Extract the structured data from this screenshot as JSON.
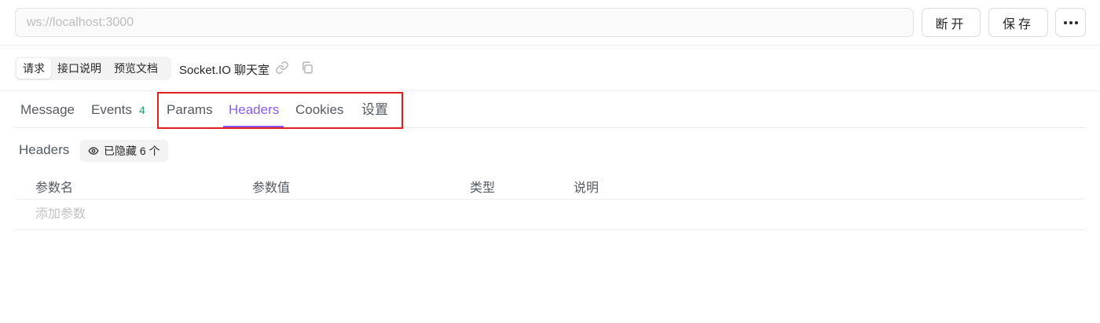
{
  "toolbar": {
    "url_placeholder": "ws://localhost:3000",
    "disconnect_label": "断开",
    "save_label": "保存",
    "more_icon": "more-horizontal-icon"
  },
  "subbar": {
    "segments": [
      "请求",
      "接口说明",
      "预览文档"
    ],
    "active_segment": "请求",
    "title": "Socket.IO 聊天室"
  },
  "tabs": {
    "items": [
      {
        "label": "Message"
      },
      {
        "label": "Events",
        "badge": "4"
      },
      {
        "label": "Params"
      },
      {
        "label": "Headers"
      },
      {
        "label": "Cookies"
      },
      {
        "label": "设置"
      }
    ],
    "active": "Headers"
  },
  "headers_section": {
    "label": "Headers",
    "hidden_text": "已隐藏 6 个"
  },
  "table": {
    "columns": [
      "参数名",
      "参数值",
      "类型",
      "说明"
    ],
    "add_placeholder": "添加参数"
  },
  "colors": {
    "accent": "#8b5cf6",
    "badge": "#22a06b",
    "highlight": "#e0201f"
  }
}
